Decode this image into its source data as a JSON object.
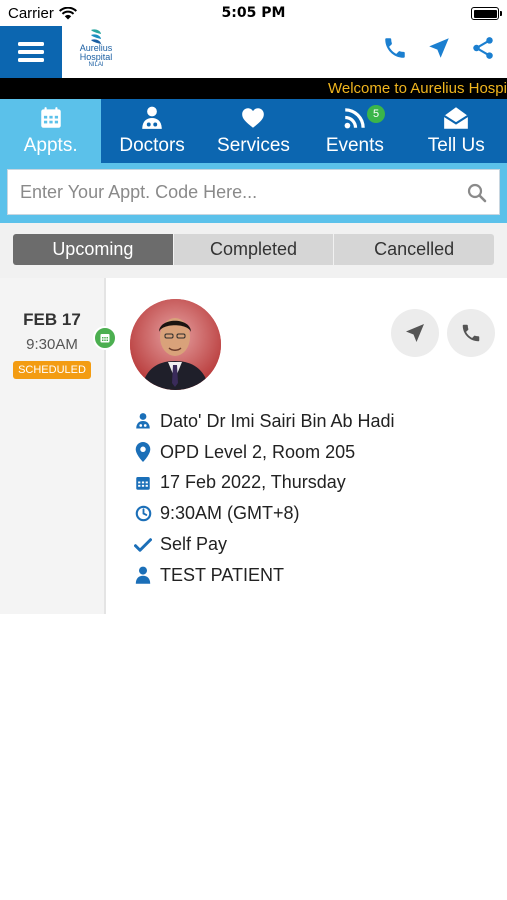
{
  "status_bar": {
    "carrier": "Carrier",
    "time": "5:05 PM"
  },
  "header": {
    "logo_name_line1": "Aurelius",
    "logo_name_line2": "Hospital",
    "logo_sub": "NILAI",
    "icons": [
      "menu-icon",
      "phone-icon",
      "navigation-icon",
      "share-icon"
    ]
  },
  "ticker": {
    "text": "Welcome to Aurelius Hospital"
  },
  "tabs": [
    {
      "label": "Appts.",
      "icon": "calendar-icon",
      "active": true
    },
    {
      "label": "Doctors",
      "icon": "doctor-icon"
    },
    {
      "label": "Services",
      "icon": "heart-icon"
    },
    {
      "label": "Events",
      "icon": "rss-icon",
      "badge": "5"
    },
    {
      "label": "Tell Us",
      "icon": "envelope-icon"
    }
  ],
  "search": {
    "placeholder": "Enter Your Appt. Code Here...",
    "value": ""
  },
  "segments": [
    {
      "label": "Upcoming",
      "active": true
    },
    {
      "label": "Completed"
    },
    {
      "label": "Cancelled"
    }
  ],
  "appointment": {
    "date": "FEB 17",
    "time": "9:30AM",
    "status": "SCHEDULED",
    "doctor": "Dato' Dr Imi Sairi Bin Ab Hadi",
    "location": "OPD Level 2, Room 205",
    "date_full": "17 Feb 2022, Thursday",
    "time_full": "9:30AM (GMT+8)",
    "payment": "Self Pay",
    "patient": "TEST PATIENT"
  },
  "colors": {
    "primary": "#0c66b0",
    "accent": "#5bc1ea",
    "ticker_text": "#f0b51e",
    "badge": "#3bb54a",
    "scheduled": "#f39c12"
  }
}
